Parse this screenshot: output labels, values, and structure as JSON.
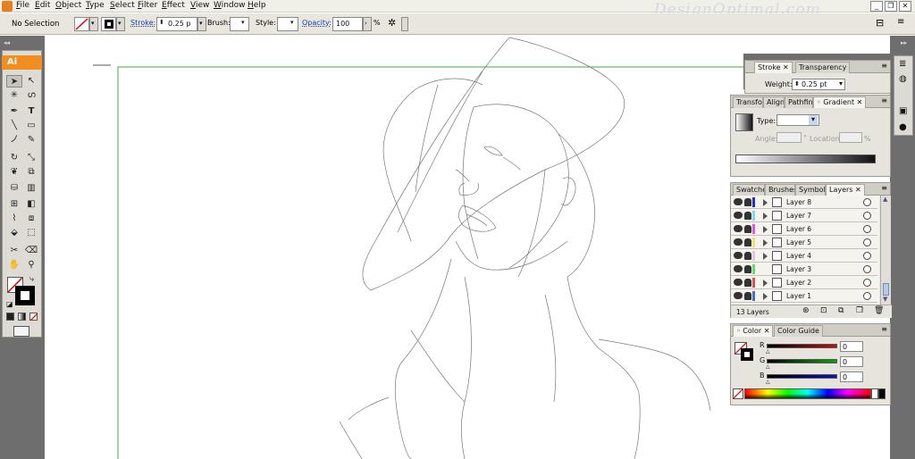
{
  "app": {
    "icon_label": "Ai",
    "watermark": "DesignOptimal.com"
  },
  "menu": [
    "File",
    "Edit",
    "Object",
    "Type",
    "Select",
    "Filter",
    "Effect",
    "View",
    "Window",
    "Help"
  ],
  "control": {
    "selection": "No Selection",
    "stroke_label": "Stroke:",
    "stroke_value": "0.25 p",
    "brush_label": "Brush:",
    "style_label": "Style:",
    "opacity_label": "Opacity:",
    "opacity_value": "100",
    "percent": "%"
  },
  "stroke_panel": {
    "tabs": [
      "Stroke",
      "Transparency"
    ],
    "weight_label": "Weight:",
    "weight_value": "0.25 pt"
  },
  "gradient_panel": {
    "tabs": [
      "Transfo",
      "Align",
      "Pathfin",
      "Gradient"
    ],
    "type_label": "Type:",
    "angle_label": "Angle:",
    "location_label": "Location:",
    "percent": "%"
  },
  "layers_panel": {
    "tabs": [
      "Swatche",
      "Brushes",
      "Symbols",
      "Layers"
    ],
    "layers": [
      {
        "name": "Layer 8",
        "color": "#2a2ad8",
        "arrow": true
      },
      {
        "name": "Layer 7",
        "color": "#7fd8ee",
        "arrow": true
      },
      {
        "name": "Layer 6",
        "color": "#e05ae0",
        "arrow": true
      },
      {
        "name": "Layer 5",
        "color": "#f0e070",
        "arrow": true
      },
      {
        "name": "Layer 4",
        "color": "#e8c4d8",
        "arrow": true
      },
      {
        "name": "Layer 3",
        "color": "#6ad86a",
        "arrow": false
      },
      {
        "name": "Layer 2",
        "color": "#d85050",
        "arrow": true
      },
      {
        "name": "Layer 1",
        "color": "#4a6ad8",
        "arrow": true
      }
    ],
    "count": "13 Layers"
  },
  "color_panel": {
    "tabs": [
      "Color",
      "Color Guide"
    ],
    "channels": [
      {
        "label": "R",
        "value": "0",
        "color": "#c01010"
      },
      {
        "label": "G",
        "value": "0",
        "color": "#10a010"
      },
      {
        "label": "B",
        "value": "0",
        "color": "#1010c0"
      }
    ]
  },
  "colors": {
    "accent": "#f08e22",
    "artboard": "#3cae3c",
    "panel": "#e6e4dc",
    "strip": "#6e6e6e"
  },
  "icons": [
    "selection-tool-icon",
    "direct-selection-icon",
    "magic-wand-icon",
    "lasso-icon",
    "pen-icon",
    "type-icon",
    "line-icon",
    "rectangle-icon",
    "paintbrush-icon",
    "pencil-icon",
    "rotate-icon",
    "scale-icon",
    "warp-icon",
    "free-transform-icon",
    "symbol-sprayer-icon",
    "graph-icon",
    "mesh-icon",
    "gradient-icon",
    "eyedropper-icon",
    "blend-icon",
    "live-paint-icon",
    "live-paint-select-icon",
    "slice-icon",
    "eraser-icon",
    "hand-icon",
    "zoom-icon"
  ]
}
